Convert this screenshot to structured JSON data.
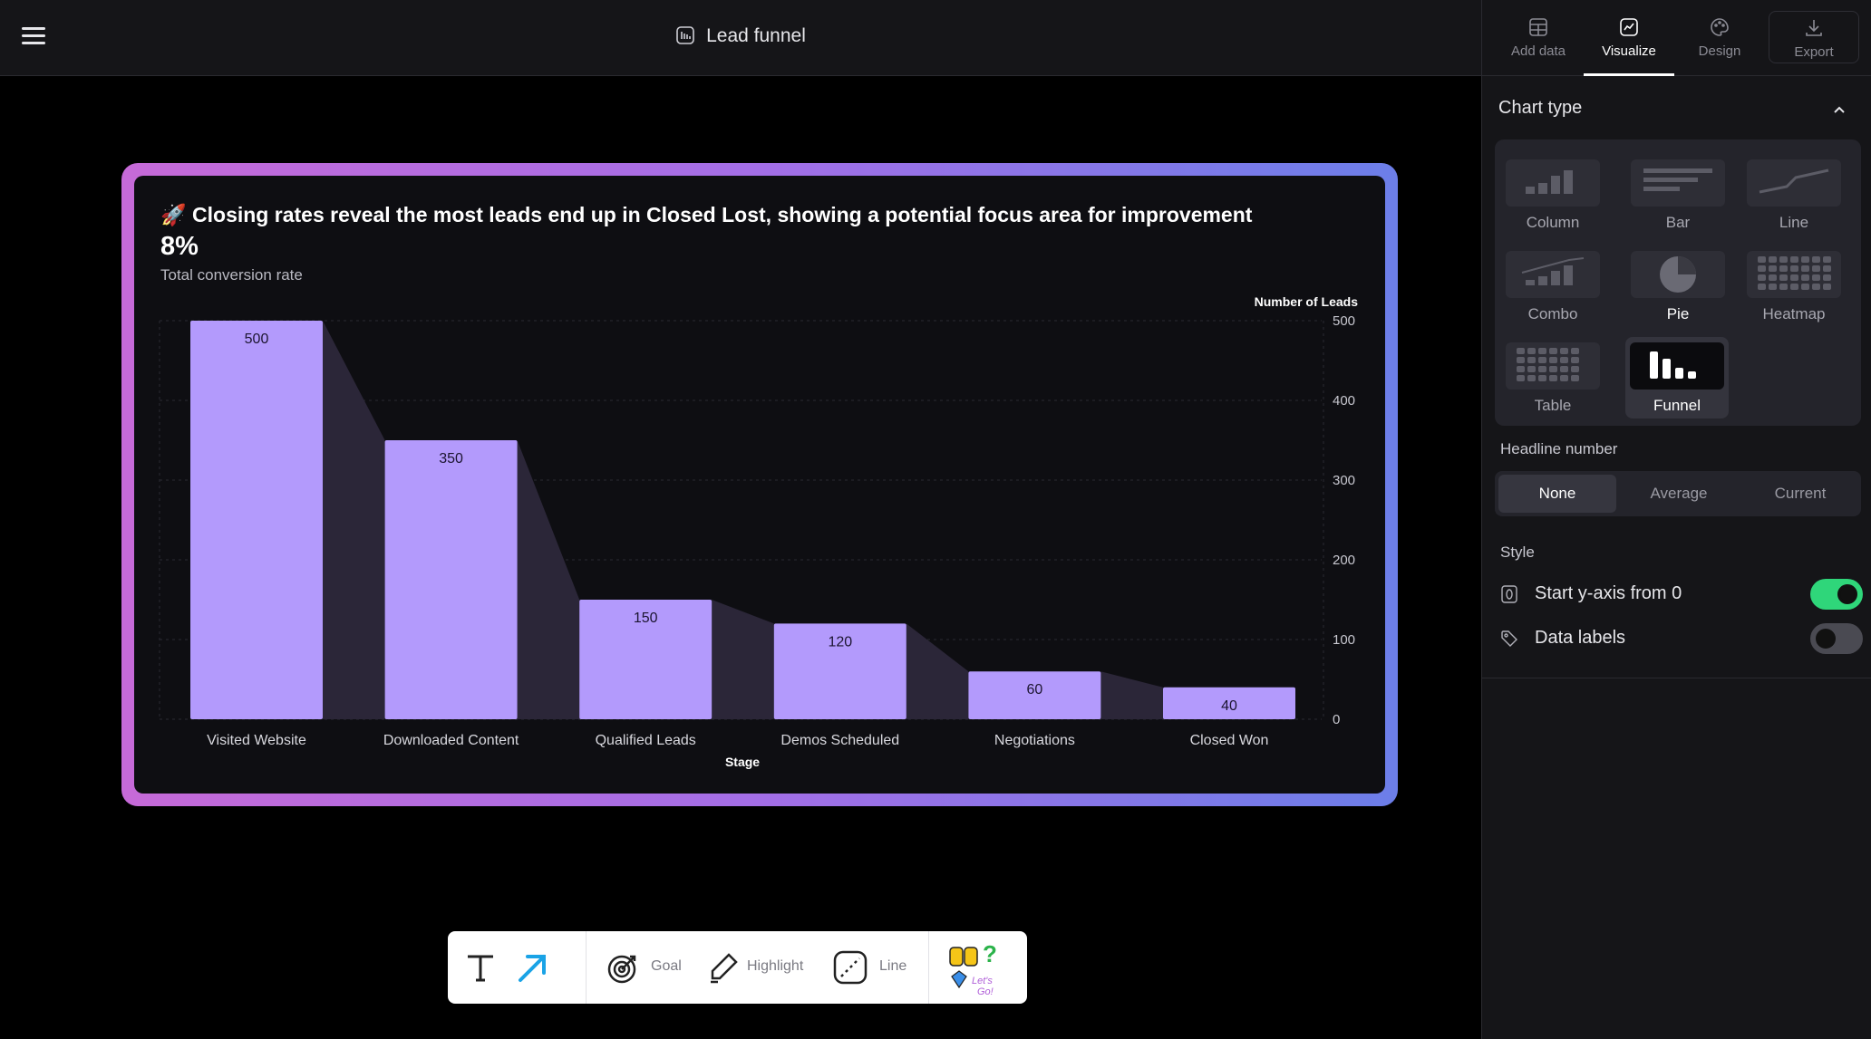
{
  "header": {
    "title": "Lead funnel"
  },
  "tabs": [
    {
      "label": "Add data",
      "icon": "table-icon"
    },
    {
      "label": "Visualize",
      "icon": "chart-line-icon",
      "active": true
    },
    {
      "label": "Design",
      "icon": "palette-icon"
    },
    {
      "label": "Export",
      "icon": "download-icon"
    }
  ],
  "panel": {
    "chart_type_title": "Chart type",
    "chart_types": [
      {
        "label": "Column"
      },
      {
        "label": "Bar"
      },
      {
        "label": "Line"
      },
      {
        "label": "Combo"
      },
      {
        "label": "Pie"
      },
      {
        "label": "Heatmap"
      },
      {
        "label": "Table"
      },
      {
        "label": "Funnel",
        "selected": true
      }
    ],
    "headline_label": "Headline number",
    "headline_options": [
      "None",
      "Average",
      "Current"
    ],
    "headline_selected": "None",
    "style_label": "Style",
    "style_options": [
      {
        "label": "Start y-axis from 0",
        "on": true
      },
      {
        "label": "Data labels",
        "on": false
      }
    ]
  },
  "card": {
    "headline": "🚀 Closing rates reveal the most leads end up in Closed Lost, showing a potential focus area for improvement",
    "big_number": "8%",
    "big_sub": "Total conversion rate"
  },
  "chart_data": {
    "type": "bar",
    "subtype": "funnel",
    "categories": [
      "Visited Website",
      "Downloaded Content",
      "Qualified Leads",
      "Demos Scheduled",
      "Negotiations",
      "Closed Won"
    ],
    "values": [
      500,
      350,
      150,
      120,
      60,
      40
    ],
    "xlabel": "Stage",
    "ylabel": "Number of Leads",
    "ylim": [
      0,
      500
    ],
    "yticks": [
      0,
      100,
      200,
      300,
      400,
      500
    ],
    "grid": true,
    "bar_color": "#b39afc",
    "connector_color": "#2b2638"
  },
  "toolbar": {
    "goal_label": "Goal",
    "highlight_label": "Highlight",
    "line_label": "Line"
  },
  "colors": {
    "accent_green": "#2fd67a",
    "card_gradient": [
      "#c66ad8",
      "#6c7ee8"
    ]
  }
}
